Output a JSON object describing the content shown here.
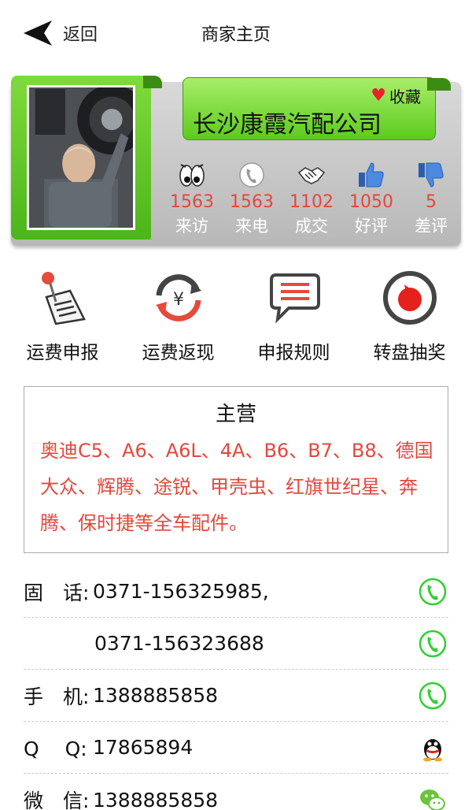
{
  "header": {
    "back_label": "返回",
    "title": "商家主页"
  },
  "profile": {
    "company_name": "长沙康霞汽配公司",
    "favorite_label": "收藏",
    "stats": [
      {
        "icon": "eyes-icon",
        "value": "1563",
        "label": "来访"
      },
      {
        "icon": "phone-icon",
        "value": "1563",
        "label": "来电"
      },
      {
        "icon": "handshake-icon",
        "value": "1102",
        "label": "成交"
      },
      {
        "icon": "thumbs-up-icon",
        "value": "1050",
        "label": "好评"
      },
      {
        "icon": "thumbs-down-icon",
        "value": "5",
        "label": "差评"
      }
    ]
  },
  "actions": [
    {
      "icon": "pin-document-icon",
      "label": "运费申报"
    },
    {
      "icon": "yuan-refresh-icon",
      "label": "运费返现"
    },
    {
      "icon": "message-icon",
      "label": "申报规则"
    },
    {
      "icon": "lottery-wheel-icon",
      "label": "转盘抽奖"
    }
  ],
  "business": {
    "title": "主营",
    "text": "奥迪C5、A6、A6L、4A、B6、B7、B8、德国大众、辉腾、途锐、甲壳虫、红旗世纪星、奔腾、保时捷等全车配件。"
  },
  "contacts": [
    {
      "label": "固　话:",
      "value": "0371-156325985,",
      "icon": "phone-call-icon"
    },
    {
      "label": "",
      "value": "0371-156323688",
      "icon": "phone-call-icon"
    },
    {
      "label": "手　机:",
      "value": "1388885858",
      "icon": "phone-call-icon"
    },
    {
      "label": "Q　 Q:",
      "value": "17865894",
      "icon": "qq-icon"
    },
    {
      "label": "微　信:",
      "value": "1388885858",
      "icon": "wechat-icon"
    }
  ],
  "colors": {
    "accent_green": "#5ccb1d",
    "stat_red": "#e4473c",
    "heart_red": "#e8222b"
  }
}
